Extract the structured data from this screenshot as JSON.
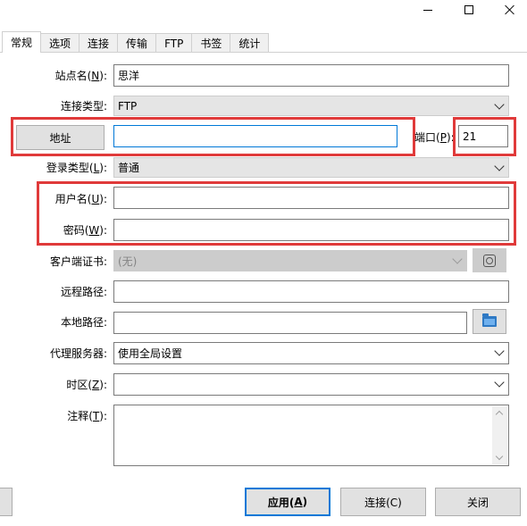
{
  "window": {
    "controls": [
      "minimize",
      "maximize",
      "close"
    ]
  },
  "tabs": [
    {
      "label": "常规"
    },
    {
      "label": "选项"
    },
    {
      "label": "连接"
    },
    {
      "label": "传输"
    },
    {
      "label": "FTP"
    },
    {
      "label": "书签"
    },
    {
      "label": "统计"
    }
  ],
  "form": {
    "site_name": {
      "label": "站点名(",
      "key": "N",
      "suffix": "):",
      "value": "思洋"
    },
    "conn_type": {
      "label": "连接类型",
      "suffix": ":",
      "value": "FTP"
    },
    "address": {
      "button": "地址",
      "value": ""
    },
    "port": {
      "label": "端口(",
      "key": "P",
      "suffix": "):",
      "value": "21"
    },
    "login_type": {
      "label": "登录类型(",
      "key": "L",
      "suffix": "):",
      "value": "普通"
    },
    "username": {
      "label": "用户名(",
      "key": "U",
      "suffix": "):",
      "value": ""
    },
    "password": {
      "label": "密码(",
      "key": "W",
      "suffix": "):",
      "value": ""
    },
    "client_cert": {
      "label": "客户端证书:",
      "value": "(无)"
    },
    "remote_path": {
      "label": "远程路径:",
      "value": ""
    },
    "local_path": {
      "label": "本地路径:",
      "value": ""
    },
    "proxy": {
      "label": "代理服务器:",
      "value": "使用全局设置"
    },
    "timezone": {
      "label": "时区(",
      "key": "Z",
      "suffix": "):",
      "value": ""
    },
    "comment": {
      "label": "注释(",
      "key": "T",
      "suffix": "):",
      "value": ""
    }
  },
  "buttons": {
    "apply": {
      "label": "应用(",
      "key": "A",
      "suffix": ")"
    },
    "connect": {
      "label": "连接(C)"
    },
    "close": {
      "label": "关闭"
    }
  },
  "colors": {
    "highlight": "#e03a3a",
    "focus": "#0078d7"
  }
}
